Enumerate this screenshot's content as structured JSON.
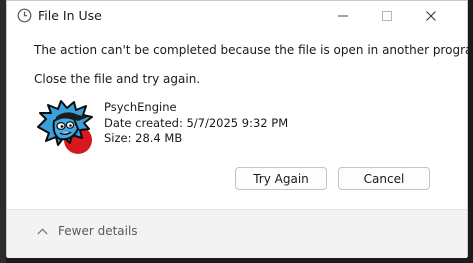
{
  "window": {
    "title": "File In Use",
    "icons": [
      "clock-icon",
      "minimize-icon",
      "maximize-icon",
      "close-icon"
    ]
  },
  "message": {
    "primary": "The action can't be completed because the file is open in another program",
    "secondary": "Close the file and try again."
  },
  "file": {
    "name": "PsychEngine",
    "date_created": "Date created: 5/7/2025 9:32 PM",
    "size": "Size: 28.4 MB",
    "icon": "psych-engine-app-icon"
  },
  "buttons": {
    "try_again": "Try Again",
    "cancel": "Cancel"
  },
  "footer": {
    "details_label": "Fewer details",
    "details_icon": "chevron-up-icon"
  },
  "colors": {
    "dialog_bg": "#ffffff",
    "footer_bg": "#f3f3f3",
    "backdrop": "#1b1b1b",
    "icon_blue": "#39a0dc",
    "icon_red": "#d7191f"
  }
}
